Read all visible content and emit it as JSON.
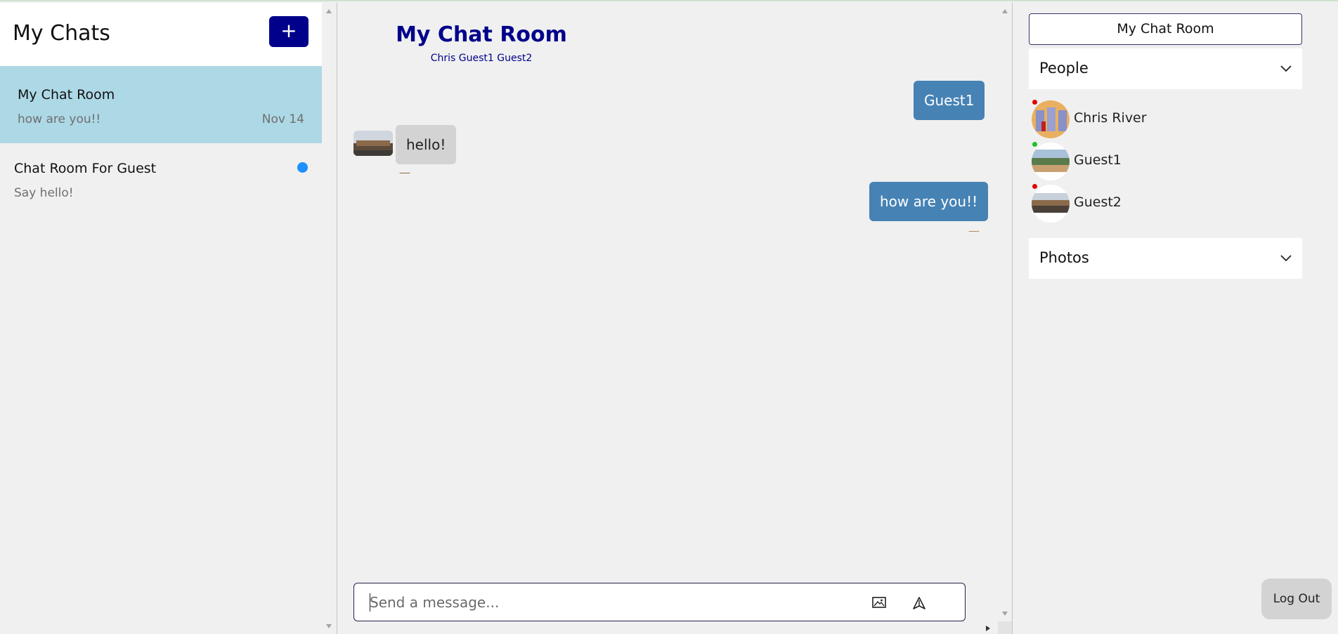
{
  "sidebar": {
    "title": "My Chats",
    "new_chat_label": "+",
    "chats": [
      {
        "title": "My Chat Room",
        "last_message": "how are you!!",
        "date": "Nov 14",
        "active": true,
        "unread": false
      },
      {
        "title": "Chat Room For Guest",
        "last_message": "Say hello!",
        "date": "",
        "active": false,
        "unread": true
      }
    ]
  },
  "room": {
    "title": "My Chat Room",
    "members": "Chris Guest1 Guest2",
    "messages": [
      {
        "text": "Guest1",
        "mine": true
      },
      {
        "text": "hello!",
        "mine": false
      },
      {
        "text": "how are you!!",
        "mine": true
      }
    ]
  },
  "composer": {
    "placeholder": "Send a message...",
    "value": ""
  },
  "details": {
    "room_button_label": "My Chat Room",
    "people_label": "People",
    "photos_label": "Photos",
    "people": [
      {
        "name": "Chris River",
        "status_color": "#e00000"
      },
      {
        "name": "Guest1",
        "status_color": "#20c020"
      },
      {
        "name": "Guest2",
        "status_color": "#e00000"
      }
    ]
  },
  "logout_label": "Log Out",
  "colors": {
    "primary": "#00008b",
    "active_chat": "#add8e6",
    "my_bubble": "#4682b4",
    "their_bubble": "#d3d3d3",
    "unread_dot": "#1e90ff"
  }
}
